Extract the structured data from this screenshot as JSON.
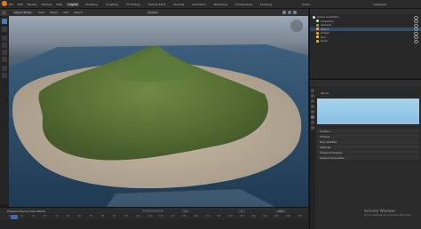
{
  "app": {
    "title": "Blender"
  },
  "topbar": {
    "items": [
      "File",
      "Edit",
      "Render",
      "Window",
      "Help"
    ],
    "tabs": [
      "Layout",
      "Modeling",
      "Sculpting",
      "UV Editing",
      "Texture Paint",
      "Shading",
      "Animation",
      "Rendering",
      "Compositing",
      "Scripting"
    ],
    "active_tab": "Layout",
    "scene": "Scene",
    "view_layer": "ViewLayer"
  },
  "viewport_header": {
    "mode": "Object Mode",
    "menus": [
      "View",
      "Select",
      "Add",
      "Object"
    ],
    "shading": "Global"
  },
  "toolbar": {
    "tools": [
      "select-box",
      "cursor",
      "move",
      "rotate",
      "scale",
      "transform",
      "annotate",
      "measure"
    ]
  },
  "outliner": {
    "title": "Scene Collection",
    "rows": [
      {
        "label": "Scene Collection",
        "icon": "collection-icon",
        "color": "#d0d0d0"
      },
      {
        "label": "Collection",
        "icon": "collection-icon",
        "color": "#d0d0d0"
      },
      {
        "label": "Camera",
        "icon": "camera-icon",
        "color": "#6fa96a"
      },
      {
        "label": "Island",
        "icon": "mesh-icon",
        "color": "#f0a43a",
        "selected": true
      },
      {
        "label": "Ocean",
        "icon": "mesh-icon",
        "color": "#f0a43a"
      },
      {
        "label": "Sun",
        "icon": "light-icon",
        "color": "#e2c75b"
      },
      {
        "label": "Sand",
        "icon": "mesh-icon",
        "color": "#f0a43a"
      }
    ]
  },
  "properties": {
    "header": "World",
    "section": "Surface",
    "sky_color": "#a8d3ec",
    "rows": [
      "Surface",
      "Volume",
      "Ray Visibility",
      "Settings",
      "Viewport Display",
      "Custom Properties"
    ]
  },
  "timeline": {
    "menus": [
      "Playback",
      "Keying",
      "View",
      "Marker"
    ],
    "frames": [
      "0",
      "10",
      "20",
      "30",
      "40",
      "50",
      "60",
      "70",
      "80",
      "90",
      "100",
      "110",
      "120",
      "130",
      "140",
      "150",
      "160",
      "170",
      "180",
      "190",
      "200",
      "210",
      "220",
      "230",
      "240",
      "250"
    ],
    "current_frame": "1",
    "start": "1",
    "end": "250"
  },
  "watermark": {
    "line1": "Activate Windows",
    "line2": "Go to Settings to activate Windows."
  }
}
